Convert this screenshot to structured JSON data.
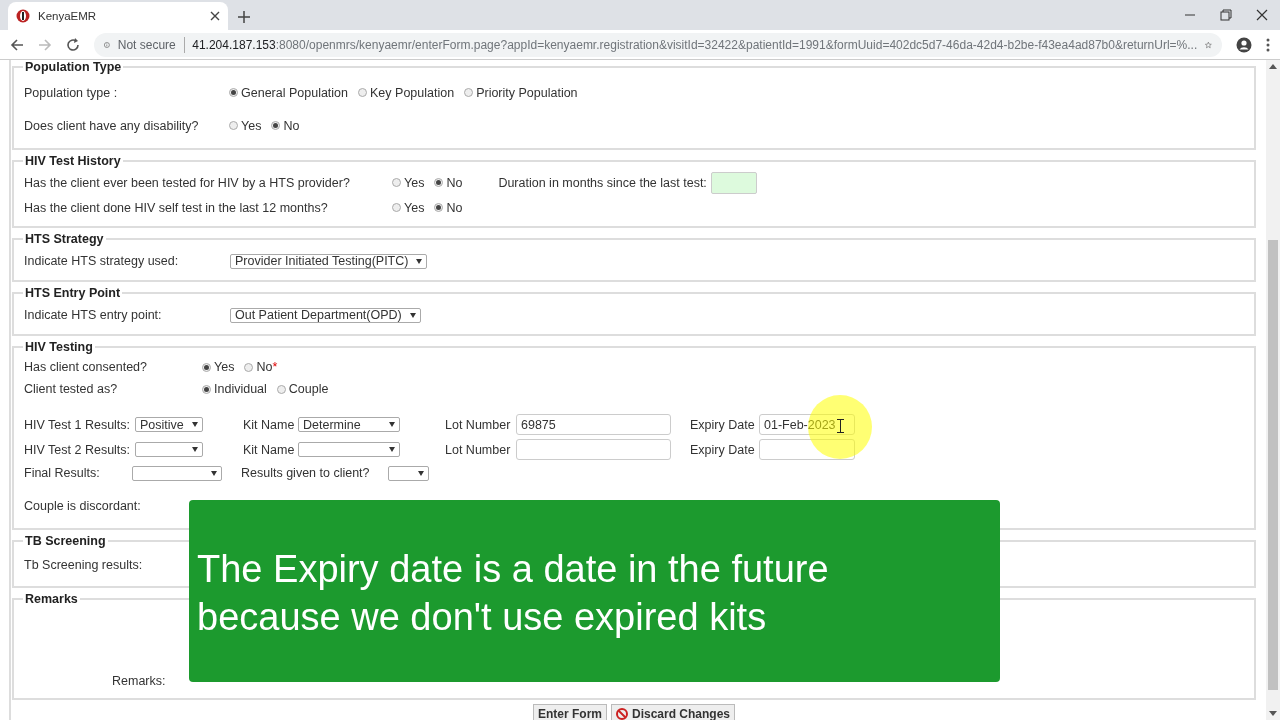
{
  "browser": {
    "tab": {
      "title": "KenyaEMR"
    },
    "address": {
      "security": "Not secure",
      "host": "41.204.187.153",
      "path": ":8080/openmrs/kenyaemr/enterForm.page?appId=kenyaemr.registration&visitId=32422&patientId=1991&formUuid=402dc5d7-46da-42d4-b2be-f43ea4ad87b0&returnUrl=%..."
    }
  },
  "form": {
    "sections": [
      {
        "legend": "Population Type",
        "rows": [
          {
            "kind": "radio",
            "label": "Population type :",
            "options": [
              {
                "label": "General Population",
                "selected": true
              },
              {
                "label": "Key Population",
                "selected": false
              },
              {
                "label": "Priority Population",
                "selected": false
              }
            ]
          },
          {
            "kind": "radio",
            "label": "Does client have any disability?",
            "options": [
              {
                "label": "Yes",
                "selected": false
              },
              {
                "label": "No",
                "selected": true
              }
            ]
          }
        ]
      },
      {
        "legend": "HIV Test History",
        "rows": [
          {
            "kind": "radio",
            "label": "Has the client ever been tested for HIV by a HTS provider?",
            "options": [
              {
                "label": "Yes",
                "selected": false
              },
              {
                "label": "No",
                "selected": true
              }
            ],
            "extra": {
              "label": "Duration in months since the last test:"
            }
          },
          {
            "kind": "radio",
            "label": "Has the client done HIV self test in the last 12 months?",
            "options": [
              {
                "label": "Yes",
                "selected": false
              },
              {
                "label": "No",
                "selected": true
              }
            ]
          }
        ]
      },
      {
        "legend": "HTS Strategy",
        "rows": [
          {
            "kind": "select",
            "label": "Indicate HTS strategy used:",
            "value": "Provider Initiated Testing(PITC)"
          }
        ]
      },
      {
        "legend": "HTS Entry Point",
        "rows": [
          {
            "kind": "select",
            "label": "Indicate HTS entry point:",
            "value": "Out Patient Department(OPD)"
          }
        ]
      },
      {
        "legend": "HIV Testing",
        "rows": [
          {
            "kind": "radio",
            "label": "Has client consented?",
            "options": [
              {
                "label": "Yes",
                "selected": true
              },
              {
                "label": "No",
                "selected": false,
                "marker": "*"
              }
            ]
          },
          {
            "kind": "radio",
            "label": "Client tested as?",
            "options": [
              {
                "label": "Individual",
                "selected": true
              },
              {
                "label": "Couple",
                "selected": false
              }
            ]
          },
          {
            "kind": "test",
            "label": "HIV Test 1 Results:",
            "result": "Positive",
            "kit_label": "Kit Name",
            "kit": "Determine",
            "lot_label": "Lot Number",
            "lot": "69875",
            "expiry_label": "Expiry Date",
            "expiry": "01-Feb-2023"
          },
          {
            "kind": "test",
            "label": "HIV Test 2 Results:",
            "kit_label": "Kit Name",
            "lot_label": "Lot Number",
            "expiry_label": "Expiry Date"
          },
          {
            "kind": "final",
            "label": "Final Results:",
            "given_label": "Results given to client?"
          },
          {
            "kind": "plain",
            "label": "Couple is discordant:"
          }
        ]
      },
      {
        "legend": "TB Screening",
        "rows": [
          {
            "kind": "plain",
            "label": "Tb Screening results:"
          }
        ]
      },
      {
        "legend": "Remarks",
        "rows": [
          {
            "kind": "remarks",
            "label": "Remarks:"
          }
        ]
      }
    ],
    "buttons": [
      {
        "label": "Enter Form",
        "kind": "submit"
      },
      {
        "label": "Discard Changes",
        "kind": "discard"
      }
    ]
  },
  "caption": {
    "text": "The Expiry date is a date in the future\nbecause we don't use expired kits"
  }
}
